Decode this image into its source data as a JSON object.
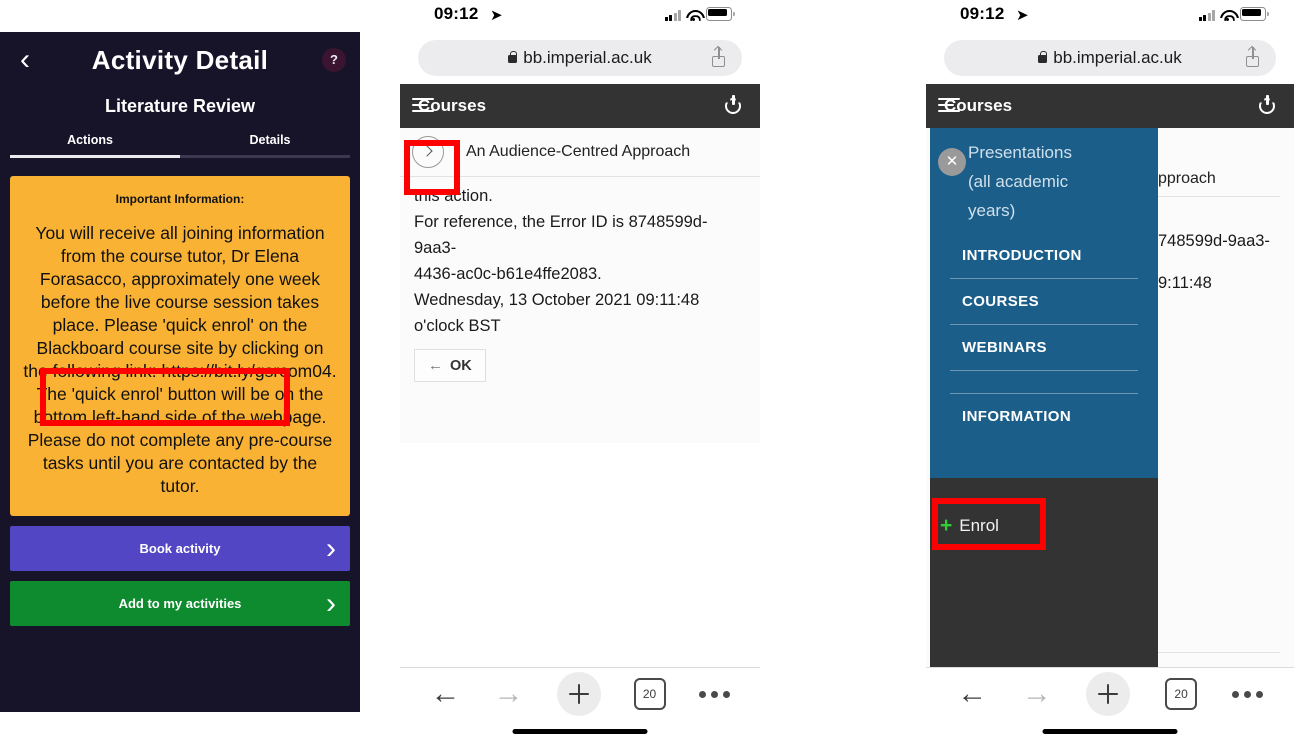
{
  "panel1": {
    "back_icon": "chevron-left-icon",
    "title": "Activity Detail",
    "help_label": "?",
    "subtitle": "Literature Review",
    "tabs": [
      {
        "label": "Actions",
        "active": true
      },
      {
        "label": "Details",
        "active": false
      }
    ],
    "card": {
      "heading": "Important Information:",
      "body": "You will receive all joining information from the course tutor, Dr Elena Forasacco, approximately one week before the live course session takes place. Please 'quick enrol' on the Blackboard course site by clicking on the following link: https://bit.ly/gsrcom04. The 'quick enrol' button will be on the bottom left-hand side of the webpage. Please do not complete any pre-course tasks until you are contacted by the tutor.",
      "highlighted_link": "https://bit.ly/gsrcom04",
      "bg_color": "#f9b233"
    },
    "buttons": [
      {
        "label": "Book activity",
        "color": "#5246c4",
        "chevron": "chevron-right-icon"
      },
      {
        "label": "Add to my activities",
        "color": "#0e8b2e",
        "chevron": "chevron-right-icon"
      }
    ]
  },
  "panel2": {
    "status": {
      "time": "09:12",
      "location_icon": "location-arrow-icon",
      "signal_icon": "cellular-bars-icon",
      "wifi_icon": "wifi-icon",
      "battery_icon": "battery-icon"
    },
    "url": {
      "lock_icon": "lock-icon",
      "text": "bb.imperial.ac.uk",
      "share_icon": "share-icon"
    },
    "bb": {
      "menu_icon": "hamburger-menu-icon",
      "title": "Courses",
      "power_icon": "power-icon"
    },
    "course_row": {
      "expand_icon": "chevron-right-circle-icon",
      "name": "An Audience-Centred Approach"
    },
    "error_lines": [
      "this action.",
      "For reference, the Error ID is 8748599d-9aa3-",
      "4436-ac0c-b61e4ffe2083.",
      "Wednesday, 13 October 2021 09:11:48",
      "o'clock BST"
    ],
    "ok_button": {
      "arrow": "←",
      "label": "OK"
    },
    "toolbar": {
      "back_icon": "←",
      "forward_icon": "→",
      "new_tab_icon": "plus-icon",
      "tab_count": "20",
      "more_icon": "ellipsis-icon"
    }
  },
  "panel3": {
    "status": {
      "time": "09:12",
      "location_icon": "location-arrow-icon",
      "signal_icon": "cellular-bars-icon",
      "wifi_icon": "wifi-icon",
      "battery_icon": "battery-icon"
    },
    "url": {
      "lock_icon": "lock-icon",
      "text": "bb.imperial.ac.uk",
      "share_icon": "share-icon"
    },
    "bb": {
      "menu_icon": "hamburger-menu-icon",
      "title": "Courses",
      "power_icon": "power-icon"
    },
    "drawer": {
      "close_icon": "✕",
      "heading_lines": [
        "Presentations",
        "(all academic",
        "years)"
      ],
      "items": [
        "INTRODUCTION",
        "COURSES",
        "WEBINARS",
        "INFORMATION"
      ],
      "bg_color": "#1b5e8a"
    },
    "enrol": {
      "plus": "+",
      "label": "Enrol",
      "plus_color": "#33cc33"
    },
    "behind": {
      "course_name_fragment": "pproach",
      "error_fragment_1": "748599d-9aa3-",
      "error_fragment_2": "9:11:48"
    },
    "toolbar": {
      "back_icon": "←",
      "forward_icon": "→",
      "new_tab_icon": "plus-icon",
      "tab_count": "20",
      "more_icon": "ellipsis-icon"
    }
  },
  "annotations": {
    "highlight_color": "#ff0000"
  }
}
